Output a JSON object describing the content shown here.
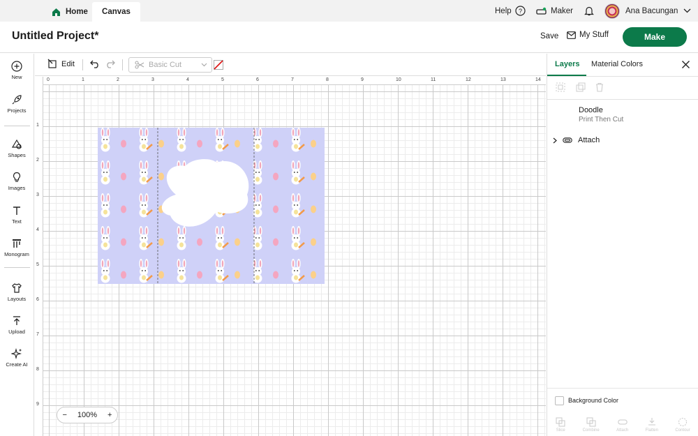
{
  "tabs": {
    "home": "Home",
    "canvas": "Canvas"
  },
  "topbar": {
    "help": "Help",
    "maker": "Maker",
    "user": "Ana Bacungan"
  },
  "project": {
    "title": "Untitled Project*",
    "save": "Save",
    "my_stuff": "My Stuff",
    "make": "Make"
  },
  "sidebar": {
    "items": [
      {
        "label": "New",
        "icon": "plus-circle-icon"
      },
      {
        "label": "Projects",
        "icon": "rocket-icon"
      },
      {
        "label": "Shapes",
        "icon": "shapes-icon"
      },
      {
        "label": "Images",
        "icon": "lightbulb-icon"
      },
      {
        "label": "Text",
        "icon": "text-icon"
      },
      {
        "label": "Monogram",
        "icon": "monogram-icon"
      },
      {
        "label": "Layouts",
        "icon": "shirt-icon"
      },
      {
        "label": "Upload",
        "icon": "upload-icon"
      },
      {
        "label": "Create AI",
        "icon": "sparkle-icon"
      }
    ]
  },
  "toolbar": {
    "edit": "Edit",
    "operation": "Basic Cut"
  },
  "rulers": {
    "top": [
      "0",
      "1",
      "2",
      "3",
      "4",
      "5",
      "6",
      "7",
      "8",
      "9",
      "10",
      "11",
      "12",
      "13",
      "14"
    ],
    "left": [
      "1",
      "2",
      "3",
      "4",
      "5",
      "6",
      "7",
      "8",
      "9"
    ]
  },
  "zoom": {
    "level": "100%",
    "minus": "−",
    "plus": "+"
  },
  "panel": {
    "tab_layers": "Layers",
    "tab_material": "Material Colors",
    "layer": {
      "name": "Doodle",
      "operation": "Print Then Cut"
    },
    "group": "Attach",
    "background_color": "Background Color",
    "bottom_tools": [
      "Slice",
      "Combine",
      "Attach",
      "Flatten",
      "Contour"
    ]
  },
  "colors": {
    "accent": "#0c7a4a",
    "pattern_bg": "#cfd1f8"
  }
}
